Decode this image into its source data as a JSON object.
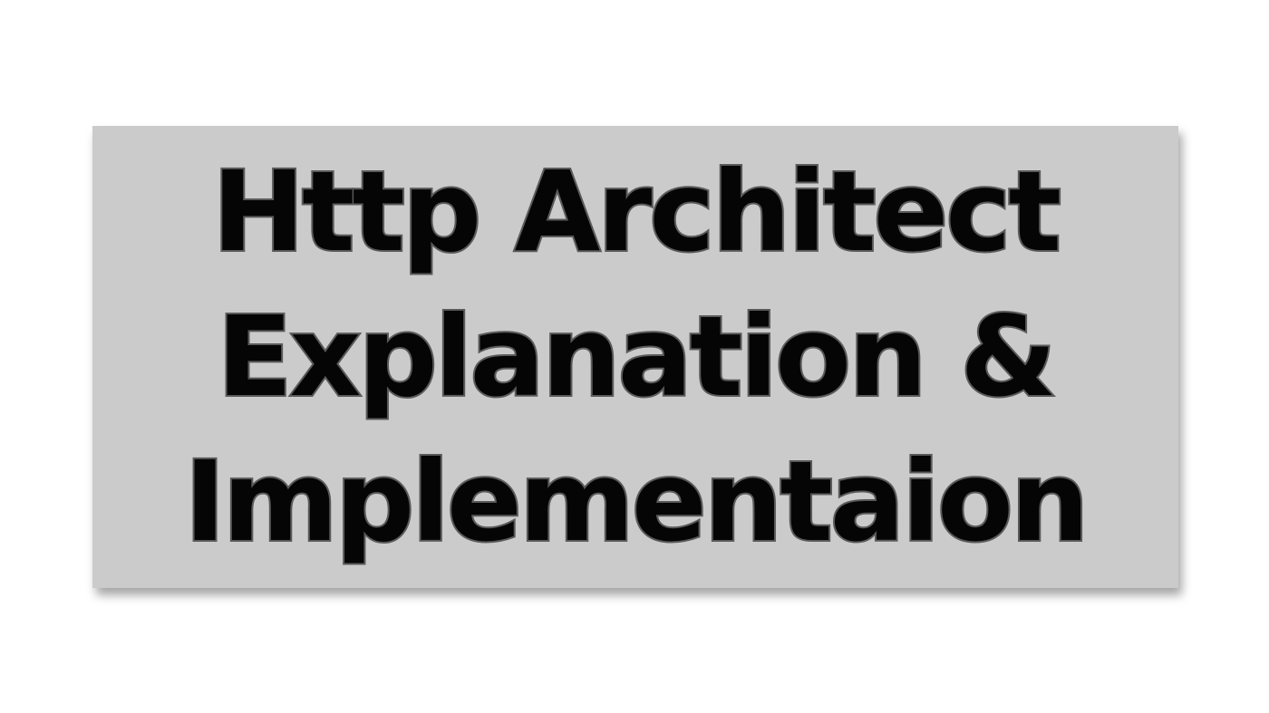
{
  "banner": {
    "lines": [
      "Http Architect",
      "Explanation &",
      "Implementaion"
    ],
    "background_color": "#cbcbcb",
    "text_color": "#050505",
    "outline_color": "#5a5a5a"
  }
}
